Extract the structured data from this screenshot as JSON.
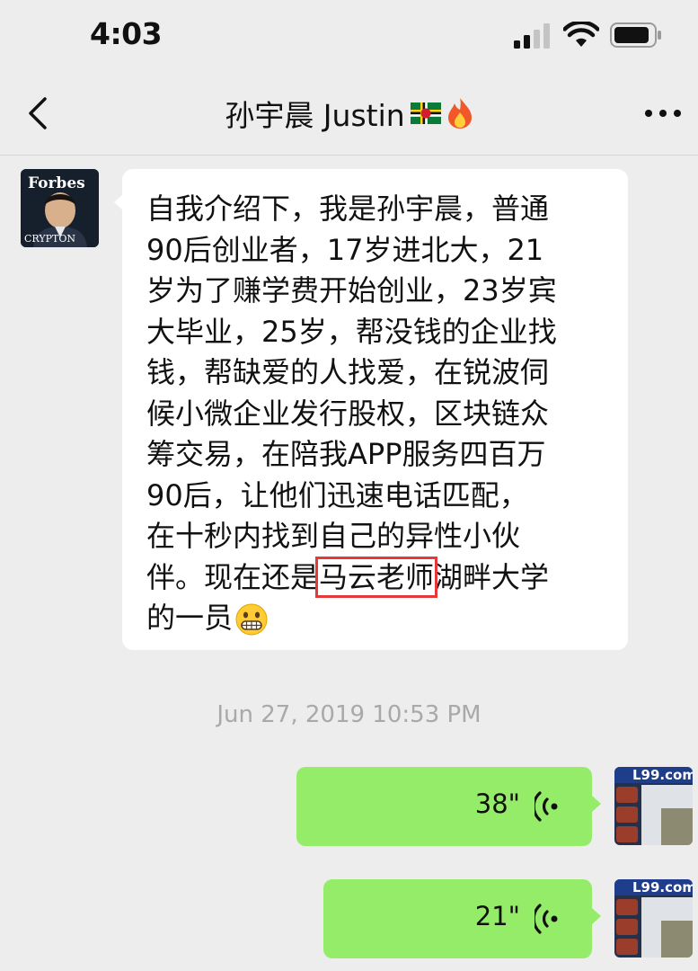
{
  "status_bar": {
    "time": "4:03"
  },
  "nav": {
    "title": "孙宇晨 Justin",
    "back_icon": "chevron-left-icon",
    "more_icon": "ellipsis-icon"
  },
  "contact_avatar": {
    "cover_title": "Forbes",
    "cover_footer": "CRYPTON"
  },
  "message": {
    "lines": [
      "自我介绍下，我是孙宇晨，普通",
      "90后创业者，17岁进北大，21",
      "岁为了赚学费开始创业，23岁宾",
      "大毕业，25岁，帮没钱的企业找",
      "钱，帮缺爱的人找爱，在锐波伺",
      "候小微企业发行股权，区块链众",
      "筹交易，在陪我APP服务四百万",
      "90后，让他们迅速电话匹配，",
      "在十秒内找到自己的异性小伙"
    ],
    "line10_before": "伴。现在还是",
    "line10_highlight": "马云老师",
    "line10_after": "湖畔大学",
    "line11": "的一员"
  },
  "timestamp": "Jun 27, 2019 10:53 PM",
  "voice_messages": [
    {
      "duration": "38\""
    },
    {
      "duration": "21\""
    }
  ],
  "user_avatar": {
    "brand": "L99.com"
  },
  "colors": {
    "background": "#ededed",
    "bubble_incoming": "#ffffff",
    "bubble_outgoing": "#95ec69",
    "highlight_box": "#e23a3a",
    "timestamp_text": "#a9a9a9"
  }
}
